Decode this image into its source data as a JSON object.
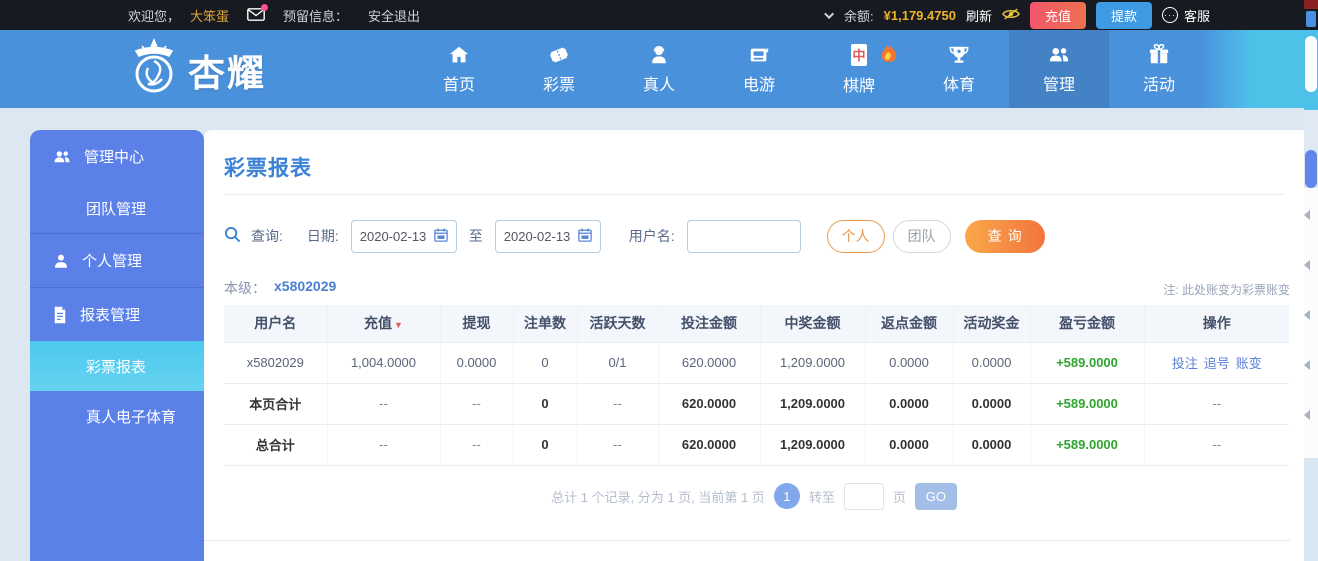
{
  "topbar": {
    "welcome_prefix": "欢迎您，",
    "username": "大笨蛋",
    "reserved_info": "预留信息：",
    "logout": "安全退出",
    "balance_label": "余额:",
    "balance_value": "¥1,179.4750",
    "refresh": "刷新",
    "deposit_btn": "充值",
    "withdraw_btn": "提款",
    "support": "客服"
  },
  "navbar": {
    "brand": "杏耀",
    "items": [
      {
        "label": "首页"
      },
      {
        "label": "彩票"
      },
      {
        "label": "真人"
      },
      {
        "label": "电游"
      },
      {
        "label": "棋牌",
        "hot": true
      },
      {
        "label": "体育"
      },
      {
        "label": "管理",
        "active": true
      },
      {
        "label": "活动"
      }
    ]
  },
  "sidebar": {
    "items": [
      {
        "label": "管理中心",
        "type": "head"
      },
      {
        "label": "团队管理",
        "type": "sub"
      },
      {
        "label": "个人管理",
        "type": "head"
      },
      {
        "label": "报表管理",
        "type": "head"
      },
      {
        "label": "彩票报表",
        "type": "sub",
        "active": true
      },
      {
        "label": "真人电子体育",
        "type": "sub"
      }
    ]
  },
  "main": {
    "title": "彩票报表",
    "search": {
      "query_label": "查询:",
      "date_label": "日期:",
      "date_from": "2020-02-13",
      "to_label": "至",
      "date_to": "2020-02-13",
      "username_label": "用户名:",
      "username_value": "",
      "personal_btn": "个人",
      "team_btn": "团队",
      "search_btn": "查询"
    },
    "level_label": "本级：",
    "level_value": "x5802029",
    "note": "注: 此处账变为彩票账变",
    "table": {
      "headers": [
        "用户名",
        "充值",
        "提现",
        "注单数",
        "活跃天数",
        "投注金额",
        "中奖金额",
        "返点金额",
        "活动奖金",
        "盈亏金额",
        "操作"
      ],
      "sorted_header": "充值",
      "rows": [
        {
          "cells": [
            "x5802029",
            "1,004.0000",
            "0.0000",
            "0",
            "0/1",
            "620.0000",
            "1,209.0000",
            "0.0000",
            "0.0000"
          ],
          "profit": "+589.0000",
          "actions": [
            "投注",
            "追号",
            "账变"
          ],
          "bold": false
        },
        {
          "cells": [
            "本页合计",
            "--",
            "--",
            "0",
            "--",
            "620.0000",
            "1,209.0000",
            "0.0000",
            "0.0000"
          ],
          "profit": "+589.0000",
          "actions": null,
          "bold": true
        },
        {
          "cells": [
            "总合计",
            "--",
            "--",
            "0",
            "--",
            "620.0000",
            "1,209.0000",
            "0.0000",
            "0.0000"
          ],
          "profit": "+589.0000",
          "actions": null,
          "bold": true
        }
      ]
    },
    "pagination": {
      "summary": "总计 1 个记录, 分为 1 页, 当前第 1 页",
      "current_page": "1",
      "goto_label": "转至",
      "page_unit": "页",
      "go_btn": "GO"
    }
  },
  "colors": {
    "accent_blue": "#4a91dc",
    "sidebar_blue": "#5b81e9",
    "active_cyan": "#4cc8ee",
    "gold": "#f0b429",
    "profit_green": "#2ea52e",
    "danger_red": "#e05a5a",
    "orange_btn": "#f3743d"
  }
}
